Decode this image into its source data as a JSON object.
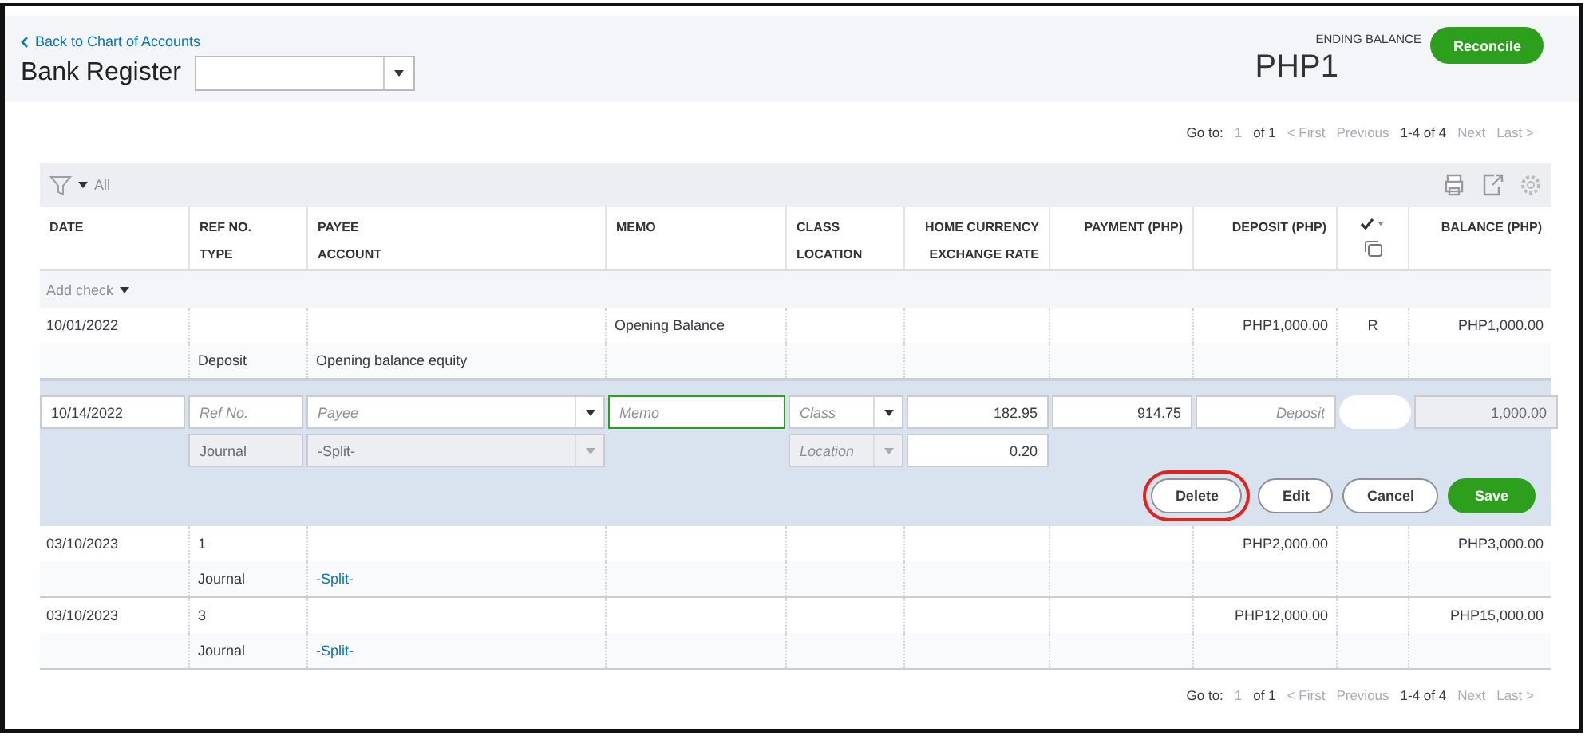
{
  "header": {
    "back_link": "Back to Chart of Accounts",
    "title": "Bank Register",
    "ending_balance_label": "ENDING BALANCE",
    "ending_balance": "PHP1",
    "reconcile_button": "Reconcile"
  },
  "pagination_top": {
    "goto_label": "Go to:",
    "page": "1",
    "of": "of 1",
    "first": "< First",
    "previous": "Previous",
    "range": "1-4 of 4",
    "next": "Next",
    "last": "Last >"
  },
  "toolbar": {
    "filter": "All"
  },
  "columns": [
    {
      "kind": "text",
      "top": "DATE"
    },
    {
      "kind": "text",
      "top": "REF NO.",
      "bottom": "TYPE"
    },
    {
      "kind": "text",
      "top": "PAYEE",
      "bottom": "ACCOUNT"
    },
    {
      "kind": "text",
      "top": "MEMO"
    },
    {
      "kind": "text",
      "top": "CLASS",
      "bottom": "LOCATION"
    },
    {
      "kind": "text",
      "top": "HOME CURRENCY",
      "bottom": "EXCHANGE RATE"
    },
    {
      "kind": "text",
      "top": "PAYMENT (PHP)"
    },
    {
      "kind": "text",
      "top": "DEPOSIT (PHP)"
    },
    {
      "kind": "reconcile"
    },
    {
      "kind": "text",
      "top": "BALANCE (PHP)"
    }
  ],
  "add_check": "Add check",
  "rows": [
    {
      "kind": "entry",
      "date": "10/01/2022",
      "type": "Deposit",
      "account": "Opening balance equity",
      "account_link": false,
      "memo": "Opening Balance",
      "deposit": "PHP1,000.00",
      "status": "R",
      "balance": "PHP1,000.00"
    },
    {
      "kind": "edit",
      "date": "10/14/2022",
      "ref_placeholder": "Ref No.",
      "payee_placeholder": "Payee",
      "memo_placeholder": "Memo",
      "class_placeholder": "Class",
      "home_currency": "182.95",
      "payment": "914.75",
      "deposit_placeholder": "Deposit",
      "balance": "1,000.00",
      "type": "Journal",
      "account": "-Split-",
      "location_placeholder": "Location",
      "exchange_rate": "0.20",
      "buttons": [
        {
          "label": "Delete",
          "kind": "plain",
          "highlighted": true
        },
        {
          "label": "Edit",
          "kind": "plain",
          "highlighted": false
        },
        {
          "label": "Cancel",
          "kind": "plain",
          "highlighted": false
        },
        {
          "label": "Save",
          "kind": "primary",
          "highlighted": false
        }
      ]
    },
    {
      "kind": "entry",
      "date": "03/10/2023",
      "ref": "1",
      "type": "Journal",
      "account": "-Split-",
      "account_link": true,
      "deposit": "PHP2,000.00",
      "balance": "PHP3,000.00"
    },
    {
      "kind": "entry",
      "date": "03/10/2023",
      "ref": "3",
      "type": "Journal",
      "account": "-Split-",
      "account_link": true,
      "deposit": "PHP12,000.00",
      "balance": "PHP15,000.00"
    }
  ],
  "pagination_bottom": {
    "goto_label": "Go to:",
    "page": "1",
    "of": "of 1",
    "first": "< First",
    "previous": "Previous",
    "range": "1-4 of 4",
    "next": "Next",
    "last": "Last >"
  }
}
